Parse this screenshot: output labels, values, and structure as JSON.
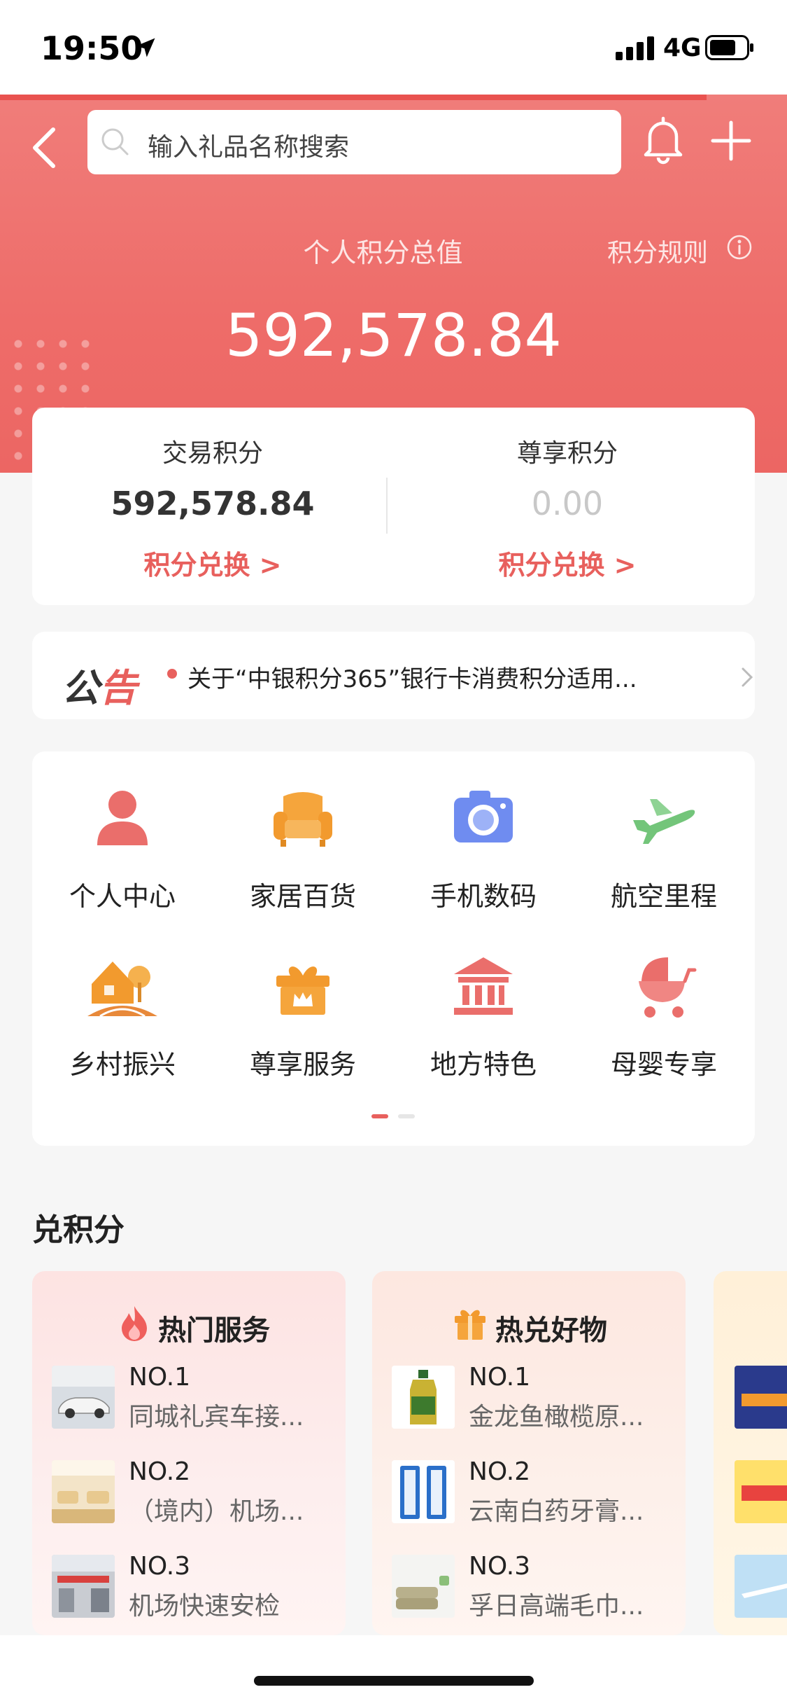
{
  "status": {
    "time": "19:50",
    "network": "4G"
  },
  "header": {
    "search_placeholder": "输入礼品名称搜索"
  },
  "hero": {
    "label": "个人积分总值",
    "rules": "积分规则",
    "total": "592,578.84"
  },
  "points": {
    "trade": {
      "title": "交易积分",
      "value": "592,578.84",
      "link": "积分兑换 >"
    },
    "premium": {
      "title": "尊享积分",
      "value": "0.00",
      "link": "积分兑换 >"
    }
  },
  "notice": {
    "logo_a": "公",
    "logo_b": "告",
    "text": "关于“中银积分365”银行卡消费积分适用..."
  },
  "menu": {
    "items": [
      {
        "label": "个人中心",
        "icon": "person-icon"
      },
      {
        "label": "家居百货",
        "icon": "sofa-icon"
      },
      {
        "label": "手机数码",
        "icon": "camera-icon"
      },
      {
        "label": "航空里程",
        "icon": "airplane-icon"
      },
      {
        "label": "乡村振兴",
        "icon": "village-icon"
      },
      {
        "label": "尊享服务",
        "icon": "gift-crown-icon"
      },
      {
        "label": "地方特色",
        "icon": "landmark-icon"
      },
      {
        "label": "母婴专享",
        "icon": "stroller-icon"
      }
    ],
    "page": 1,
    "page_count": 2
  },
  "section": {
    "title": "兑积分"
  },
  "rank_hot": {
    "title": "热门服务",
    "icon": "flame-icon",
    "items": [
      {
        "no": "NO.1",
        "name": "同城礼宾车接..."
      },
      {
        "no": "NO.2",
        "name": "（境内）机场..."
      },
      {
        "no": "NO.3",
        "name": "机场快速安检"
      }
    ]
  },
  "rank_goods": {
    "title": "热兑好物",
    "icon": "gift-icon",
    "items": [
      {
        "no": "NO.1",
        "name": "金龙鱼橄榄原..."
      },
      {
        "no": "NO.2",
        "name": "云南白药牙膏..."
      },
      {
        "no": "NO.3",
        "name": "孚日高端毛巾..."
      }
    ]
  },
  "colors": {
    "brand": "#ee6c69",
    "accent": "#e8605d"
  }
}
